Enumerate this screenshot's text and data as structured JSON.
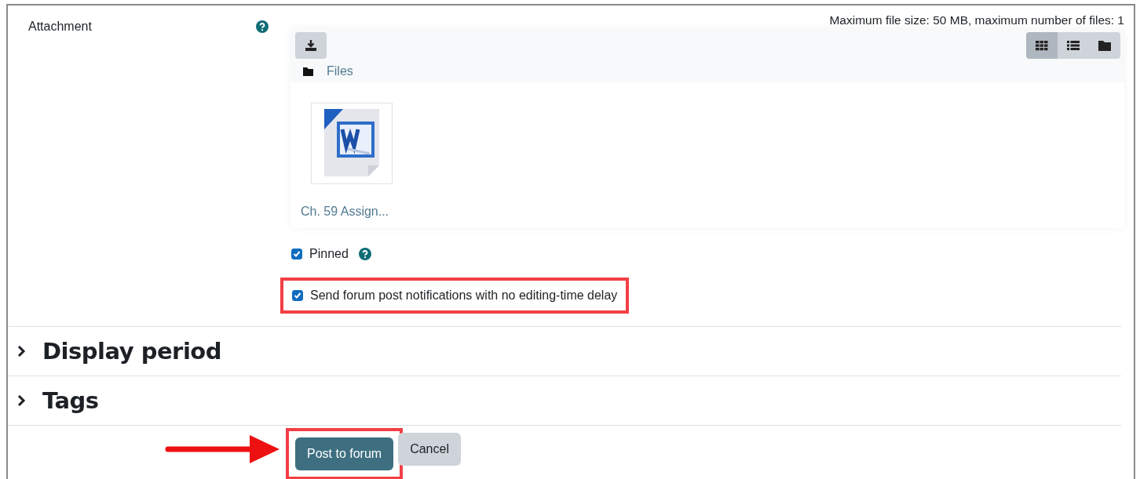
{
  "attachment": {
    "label": "Attachment",
    "help": true,
    "limits": "Maximum file size: 50 MB, maximum number of files: 1",
    "views": [
      {
        "kind": "icons",
        "selected": true
      },
      {
        "kind": "list",
        "selected": false
      },
      {
        "kind": "tree",
        "selected": false
      }
    ],
    "path": "Files",
    "files": [
      {
        "name": "Ch. 59 Assign..."
      }
    ]
  },
  "options": [
    {
      "label": "Pinned",
      "checked": true,
      "help": true,
      "highlighted": false
    },
    {
      "label": "Send forum post notifications with no editing-time delay",
      "checked": true,
      "help": false,
      "highlighted": true
    }
  ],
  "sections": [
    {
      "title": "Display period",
      "expanded": false
    },
    {
      "title": "Tags",
      "expanded": false
    }
  ],
  "buttons": [
    {
      "label": "Post to forum",
      "kind": "primary",
      "highlighted": true,
      "pointer_arrow": true
    },
    {
      "label": "Cancel",
      "kind": "secondary",
      "highlighted": false,
      "pointer_arrow": false
    }
  ]
}
